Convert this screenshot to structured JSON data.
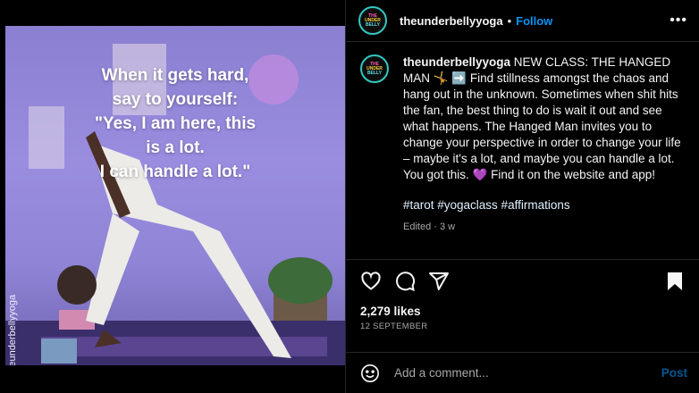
{
  "post": {
    "username": "theunderbellyyoga",
    "follow_label": "Follow",
    "avatar_text": [
      "THE",
      "UNDER",
      "BELLY"
    ],
    "media": {
      "overlay_lines": [
        "When it gets hard,",
        "say to yourself:",
        "\"Yes, I am here, this",
        "is a lot.",
        "I can handle a lot.\""
      ],
      "watermark": "@theunderbellyyoga"
    },
    "caption": {
      "username": "theunderbellyyoga",
      "body": "NEW CLASS: THE HANGED MAN 🤸 ➡️ Find stillness amongst the chaos and hang out in the unknown. Sometimes when shit hits the fan, the best thing to do is wait it out and see what happens. The Hanged Man invites you to change your perspective in order to change your life – maybe it's a lot, and maybe you can handle a lot. You got this. 💜 Find it on the website and app!",
      "hashtags": "#tarot #yogaclass #affirmations",
      "edited": "Edited · 3 w"
    },
    "likes": "2,279 likes",
    "date": "12 SEPTEMBER",
    "comment": {
      "placeholder": "Add a comment...",
      "post_label": "Post"
    }
  },
  "colors": {
    "background": "#000000",
    "follow_blue": "#0095f6",
    "photo_wall": "#9a8de0"
  },
  "icons": [
    "more-icon",
    "heart-icon",
    "comment-icon",
    "share-icon",
    "bookmark-icon",
    "emoji-icon"
  ]
}
